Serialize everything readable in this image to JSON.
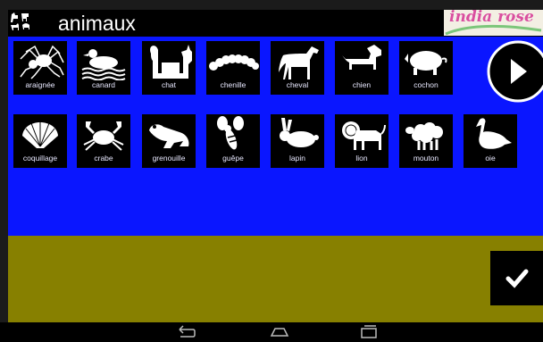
{
  "header": {
    "title": "animaux",
    "logo_text": "india rose"
  },
  "pictograms": [
    {
      "label": "araignée",
      "icon": "spider-icon"
    },
    {
      "label": "canard",
      "icon": "duck-icon"
    },
    {
      "label": "chat",
      "icon": "cat-icon"
    },
    {
      "label": "chenille",
      "icon": "caterpillar-icon"
    },
    {
      "label": "cheval",
      "icon": "horse-icon"
    },
    {
      "label": "chien",
      "icon": "dog-icon"
    },
    {
      "label": "cochon",
      "icon": "pig-icon"
    },
    {
      "label": "coquillage",
      "icon": "shell-icon"
    },
    {
      "label": "crabe",
      "icon": "crab-icon"
    },
    {
      "label": "grenouille",
      "icon": "frog-icon"
    },
    {
      "label": "guêpe",
      "icon": "wasp-icon"
    },
    {
      "label": "lapin",
      "icon": "rabbit-icon"
    },
    {
      "label": "lion",
      "icon": "lion-icon"
    },
    {
      "label": "mouton",
      "icon": "sheep-icon"
    },
    {
      "label": "oie",
      "icon": "goose-icon"
    }
  ],
  "controls": {
    "next": "play-arrow-icon",
    "validate": "checkmark-icon"
  },
  "navbar": {
    "back": "back-icon",
    "home": "home-icon",
    "recents": "recents-icon"
  },
  "colors": {
    "panel": "#0a16ff",
    "sentence_area": "#878000",
    "tile": "#000000",
    "logo_text": "#d94f9e"
  }
}
